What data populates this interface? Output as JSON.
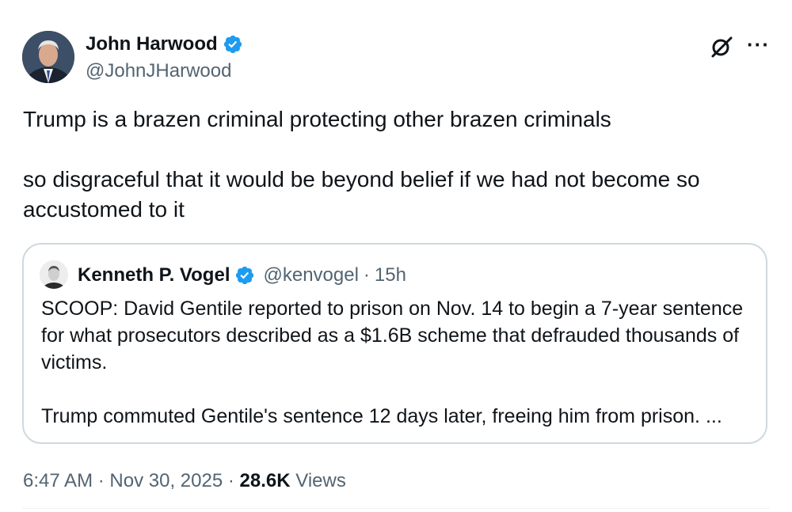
{
  "tweet": {
    "author_name": "John Harwood",
    "author_handle": "@JohnJHarwood",
    "text": "Trump is a brazen criminal protecting other brazen criminals\n\nso disgraceful that it would be beyond belief if we had not become so accustomed to it",
    "time": "6:47 AM",
    "separator": "·",
    "date": "Nov 30, 2025",
    "views_count": "28.6K",
    "views_label": "Views"
  },
  "quote": {
    "author_name": "Kenneth P. Vogel",
    "author_handle": "@kenvogel",
    "separator": "·",
    "age": "15h",
    "text": "SCOOP: David Gentile reported to prison on Nov. 14 to begin a 7-year sentence for what prosecutors described as a $1.6B scheme that defrauded thousands of victims.\n\nTrump commuted Gentile's sentence 12 days later, freeing him from prison. ..."
  },
  "icons": {
    "verified": "verified-badge-icon",
    "grok": "grok-icon",
    "more": "more-icon"
  },
  "colors": {
    "verified_blue": "#1d9bf0",
    "secondary_text": "#536471",
    "border": "#cfd9de"
  }
}
